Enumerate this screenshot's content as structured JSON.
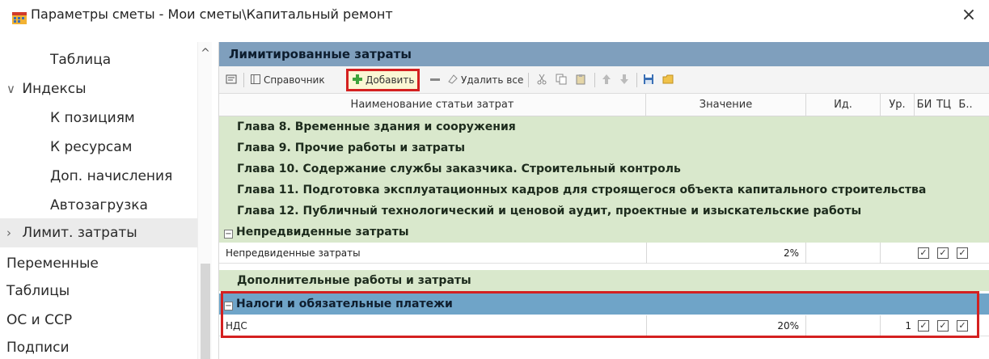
{
  "window": {
    "title": "Параметры сметы - Мои сметы\\Капитальный ремонт",
    "app_icon": "estimate-app-icon",
    "close_glyph": "×"
  },
  "sidebar": {
    "items": [
      {
        "label": "Таблица",
        "level": 1
      },
      {
        "label": "Индексы",
        "level": 0,
        "chevron": "∨"
      },
      {
        "label": "К позициям",
        "level": 1
      },
      {
        "label": "К ресурсам",
        "level": 1
      },
      {
        "label": "Доп. начисления",
        "level": 1
      },
      {
        "label": "Автозагрузка",
        "level": 1
      },
      {
        "label": "Лимит. затраты",
        "level": 0,
        "chevron": "›",
        "selected": true
      },
      {
        "label": "Переменные",
        "level": 0
      },
      {
        "label": "Таблицы",
        "level": 0
      },
      {
        "label": "ОС и ССР",
        "level": 0
      },
      {
        "label": "Подписи",
        "level": 0
      }
    ],
    "scroll_up_glyph": "^"
  },
  "panel": {
    "title": "Лимитированные затраты"
  },
  "toolbar": {
    "reference_label": "Справочник",
    "add_label": "Добавить",
    "delete_all_label": "Удалить все"
  },
  "grid": {
    "columns": [
      "Наименование статьи затрат",
      "Значение",
      "Ид.",
      "Ур.",
      "БИ",
      "ТЦ",
      "Б.."
    ],
    "rows": [
      {
        "type": "chapter",
        "label": "Глава 8. Временные здания и сооружения"
      },
      {
        "type": "chapter",
        "label": "Глава 9. Прочие работы и затраты"
      },
      {
        "type": "chapter",
        "label": "Глава 10. Содержание службы заказчика. Строительный контроль"
      },
      {
        "type": "chapter",
        "label": "Глава 11. Подготовка эксплуатационных кадров для строящегося объекта капитального строительства"
      },
      {
        "type": "chapter",
        "label": "Глава 12. Публичный технологический и ценовой аудит, проектные и изыскательские работы"
      },
      {
        "type": "group",
        "label": "Непредвиденные затраты",
        "expand": "−"
      },
      {
        "type": "item",
        "label": "Непредвиденные затраты",
        "value": "2%",
        "level": "",
        "checks": [
          "✓",
          "✓",
          "✓"
        ]
      },
      {
        "type": "chapter",
        "label": "Дополнительные работы и затраты"
      },
      {
        "type": "group-selected",
        "label": "Налоги и обязательные платежи",
        "expand": "−"
      },
      {
        "type": "item",
        "label": "НДС",
        "value": "20%",
        "level": "1",
        "checks": [
          "✓",
          "✓",
          "✓"
        ]
      }
    ]
  },
  "colors": {
    "panel_title_bg": "#7f9fbd",
    "chapter_row_bg": "#d9e8cc",
    "selected_group_bg": "#6fa4c8",
    "highlight_red": "#d42020"
  }
}
